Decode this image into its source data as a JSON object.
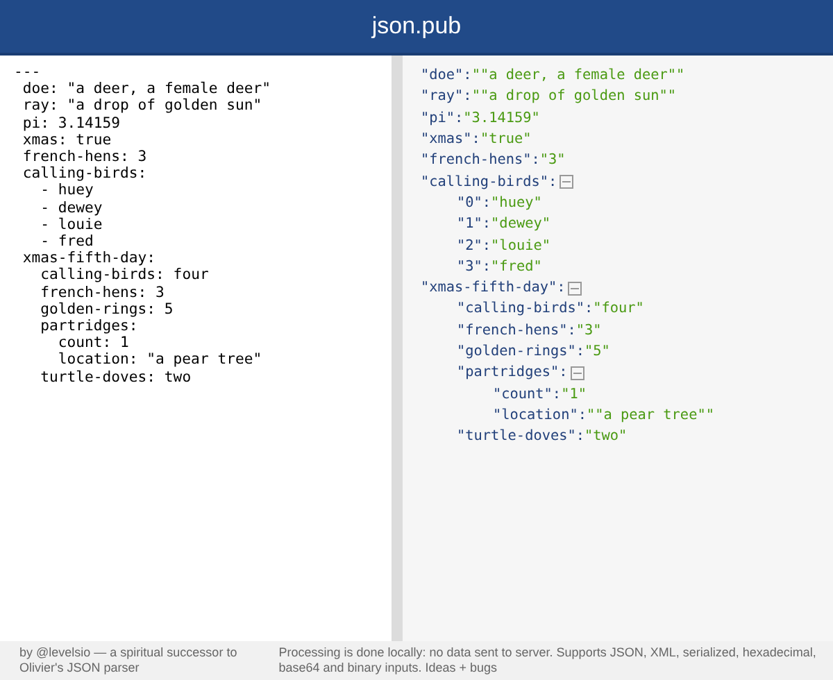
{
  "header": {
    "title": "json.pub"
  },
  "input": {
    "value": "---\n doe: \"a deer, a female deer\"\n ray: \"a drop of golden sun\"\n pi: 3.14159\n xmas: true\n french-hens: 3\n calling-birds:\n   - huey\n   - dewey\n   - louie\n   - fred\n xmas-fifth-day:\n   calling-birds: four\n   french-hens: 3\n   golden-rings: 5\n   partridges:\n     count: 1\n     location: \"a pear tree\"\n   turtle-doves: two"
  },
  "tree": [
    {
      "key": "\"doe\":",
      "value": "\"\"a deer, a female deer\"\""
    },
    {
      "key": "\"ray\":",
      "value": "\"\"a drop of golden sun\"\""
    },
    {
      "key": "\"pi\":",
      "value": "\"3.14159\""
    },
    {
      "key": "\"xmas\":",
      "value": "\"true\""
    },
    {
      "key": "\"french-hens\":",
      "value": "\"3\""
    },
    {
      "key": "\"calling-birds\":",
      "expanded": true,
      "children": [
        {
          "key": "\"0\":",
          "value": "\"huey\""
        },
        {
          "key": "\"1\":",
          "value": "\"dewey\""
        },
        {
          "key": "\"2\":",
          "value": "\"louie\""
        },
        {
          "key": "\"3\":",
          "value": "\"fred\""
        }
      ]
    },
    {
      "key": "\"xmas-fifth-day\":",
      "expanded": true,
      "children": [
        {
          "key": "\"calling-birds\":",
          "value": "\"four\""
        },
        {
          "key": "\"french-hens\":",
          "value": "\"3\""
        },
        {
          "key": "\"golden-rings\":",
          "value": "\"5\""
        },
        {
          "key": "\"partridges\":",
          "expanded": true,
          "children": [
            {
              "key": "\"count\":",
              "value": "\"1\""
            },
            {
              "key": "\"location\":",
              "value": "\"\"a pear tree\"\""
            }
          ]
        },
        {
          "key": "\"turtle-doves\":",
          "value": "\"two\""
        }
      ]
    }
  ],
  "footer": {
    "credit": "by @levelsio — a spiritual successor to Olivier's JSON parser",
    "note": "Processing is done locally: no data sent to server. Supports JSON, XML, serialized, hexadecimal, base64 and binary inputs. Ideas + bugs"
  }
}
